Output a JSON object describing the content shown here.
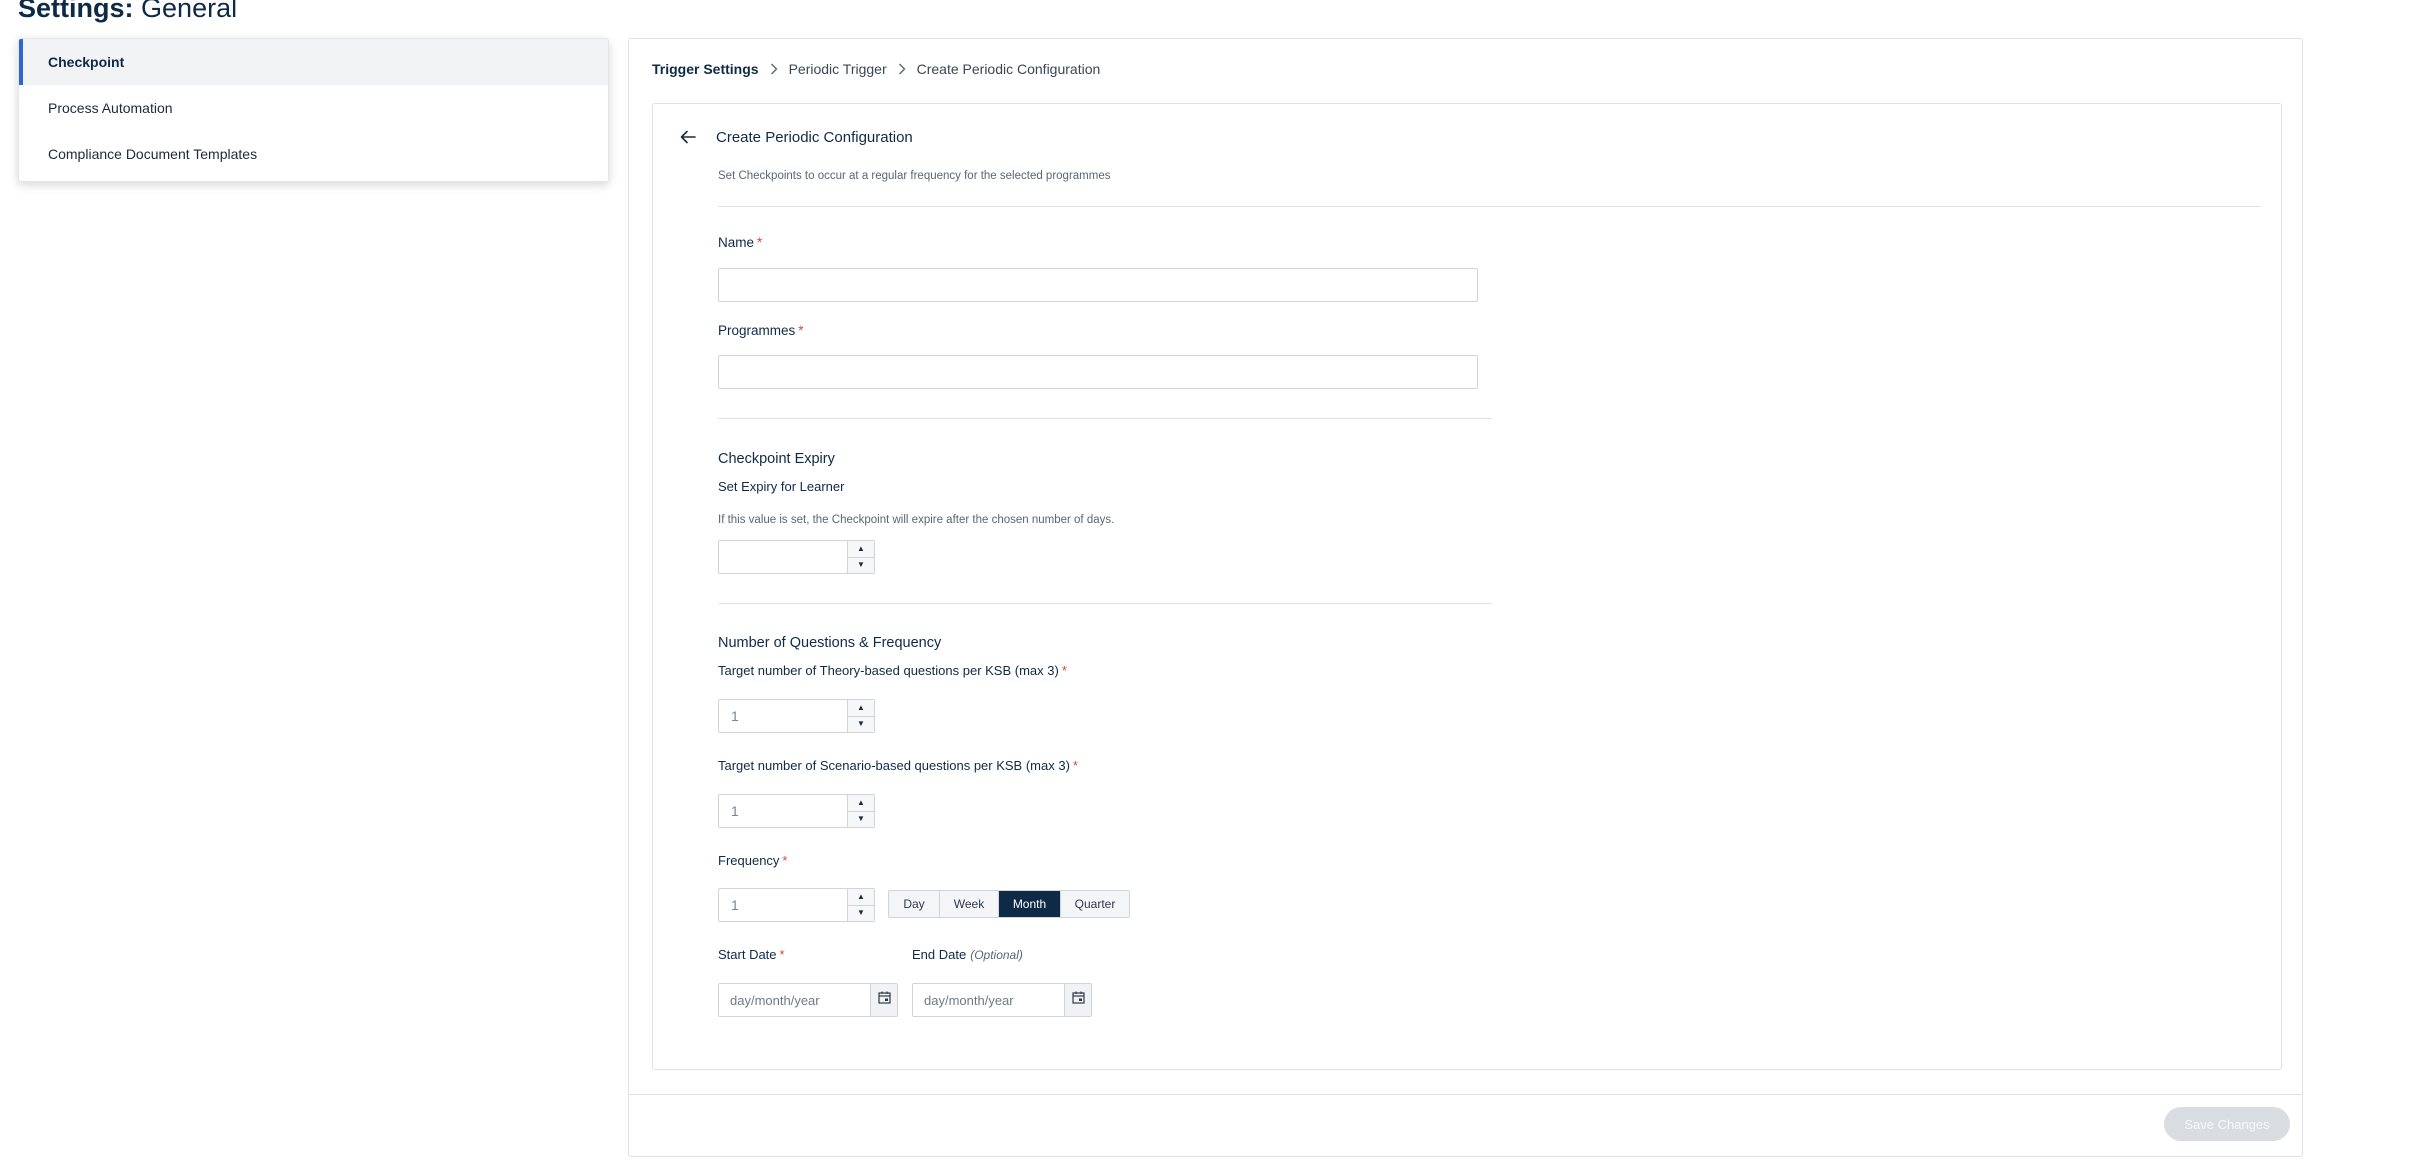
{
  "page": {
    "title_strong": "Settings:",
    "title_rest": "General"
  },
  "sidebar": {
    "items": [
      {
        "label": "Checkpoint",
        "active": true
      },
      {
        "label": "Process Automation"
      },
      {
        "label": "Compliance Document Templates"
      }
    ]
  },
  "breadcrumb": {
    "items": [
      "Trigger Settings",
      "Periodic Trigger",
      "Create Periodic Configuration"
    ]
  },
  "form": {
    "title": "Create Periodic Configuration",
    "description": "Set Checkpoints to occur at a regular frequency for the selected programmes",
    "name_label": "Name",
    "name_value": "",
    "programmes_label": "Programmes",
    "programmes_value": "",
    "required_mark": "*",
    "expiry": {
      "section_title": "Checkpoint Expiry",
      "label": "Set Expiry for Learner",
      "helper": "If this value is set, the Checkpoint will expire after the chosen number of days.",
      "value": ""
    },
    "questions": {
      "section_title": "Number of Questions & Frequency",
      "theory_label": "Target number of Theory-based questions per KSB (max 3)",
      "theory_value": "1",
      "scenario_label": "Target number of Scenario-based questions per KSB (max 3)",
      "scenario_value": "1",
      "frequency_label": "Frequency",
      "frequency_value": "1",
      "frequency_options": [
        "Day",
        "Week",
        "Month",
        "Quarter"
      ],
      "frequency_selected": "Month"
    },
    "dates": {
      "start_label": "Start Date",
      "end_label": "End Date",
      "end_optional": "(Optional)",
      "start_placeholder": "day/month/year",
      "end_placeholder": "day/month/year"
    }
  },
  "footer": {
    "save_label": "Save Changes"
  },
  "colors": {
    "primary": "#0f2a47",
    "accent": "#2f66d0",
    "required": "#d04a3c",
    "disabled_button": "#d9dde2"
  },
  "icons": {
    "back": "arrow-left-icon",
    "separator": "chevron-right-icon",
    "calendar": "calendar-icon",
    "step_up": "triangle-up-icon",
    "step_down": "triangle-down-icon"
  }
}
